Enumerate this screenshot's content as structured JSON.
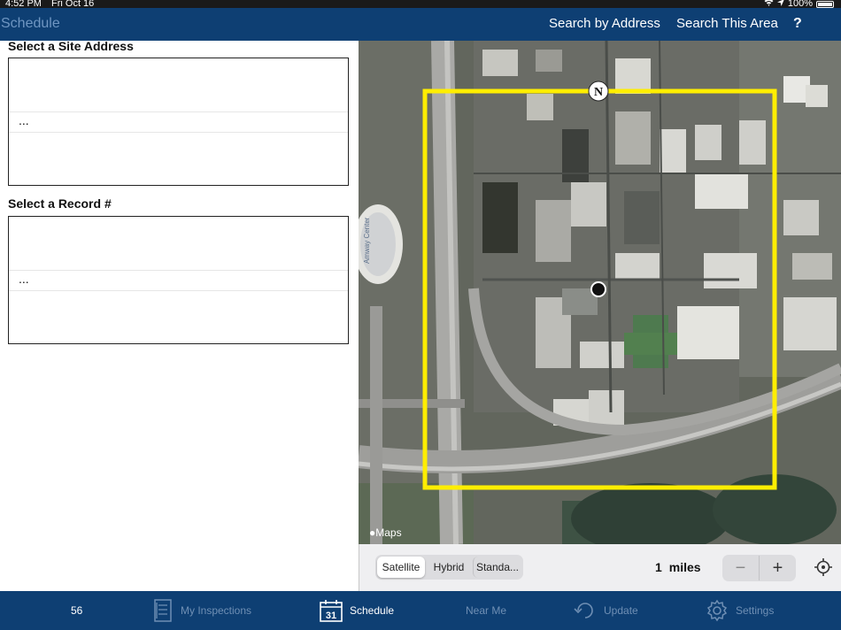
{
  "status": {
    "time": "4:52 PM",
    "date": "Fri Oct 16",
    "battery": "100%"
  },
  "nav": {
    "title": "Schedule",
    "search_address": "Search by Address",
    "search_area": "Search This Area",
    "help": "?"
  },
  "left": {
    "site_label": "Select a Site Address",
    "site_selected": "...",
    "record_label": "Select a Record #",
    "record_selected": "..."
  },
  "map": {
    "compass": "N",
    "attribution": "Maps",
    "arena_text": "Amway Center",
    "colors": {
      "boundary": "#ffee00",
      "accent": "#0e3f73"
    }
  },
  "maptools": {
    "map_types": [
      "Satellite",
      "Hybrid",
      "Standa..."
    ],
    "active_type": "Satellite",
    "radius_value": "1",
    "radius_unit": "miles",
    "minus": "−",
    "plus": "+"
  },
  "tabs": {
    "count": "56",
    "inspections": "My Inspections",
    "calendar_day": "31",
    "schedule": "Schedule",
    "near_me": "Near Me",
    "update": "Update",
    "settings": "Settings"
  }
}
